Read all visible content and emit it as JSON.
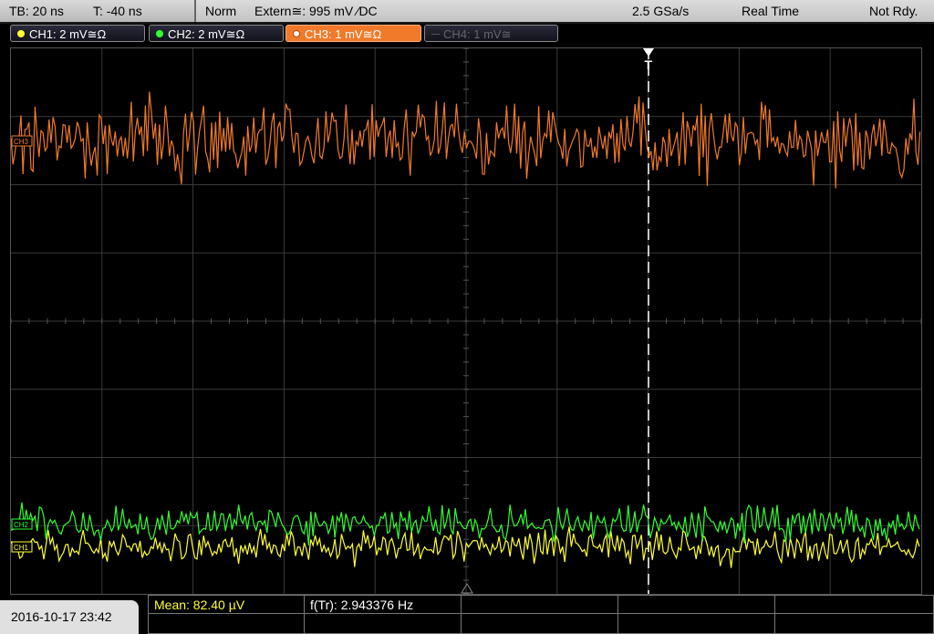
{
  "timebase": {
    "tb": "TB: 20 ns",
    "t": "T: -40 ns"
  },
  "status": {
    "mode": "Norm",
    "trigger": "Extern≅: 995 mV ⁄DC",
    "sample_rate": "2.5 GSa/s",
    "acq": "Real Time",
    "state": "Not Rdy."
  },
  "channels": [
    {
      "label": "CH1: 2 mV≅Ω",
      "color": "#ffff33"
    },
    {
      "label": "CH2: 2 mV≅Ω",
      "color": "#33ff33"
    },
    {
      "label": "CH3: 1 mV≅Ω",
      "color": "#f07a2a"
    },
    {
      "label": "CH4: 1 mV≅",
      "color": "#666666"
    }
  ],
  "markers": {
    "ch3": "CH3",
    "ch2": "CH2",
    "ch1": "CH1",
    "trigger": "T"
  },
  "bottom": {
    "datetime": "2016-10-17 23:42",
    "mean": "Mean: 82.40 µV",
    "freq": "f(Tr): 2.943376 Hz"
  },
  "colors": {
    "ch1": "#ffff33",
    "ch2": "#33ff33",
    "ch3": "#f07a2a",
    "grid": "#3a3a3a",
    "trigger_line": "#ffffff"
  }
}
